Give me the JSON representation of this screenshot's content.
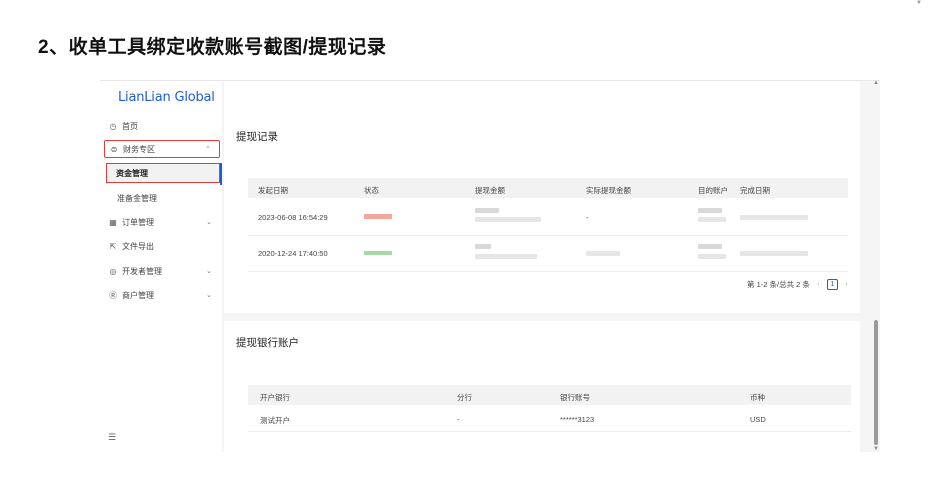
{
  "doc": {
    "heading": "2、收单工具绑定收款账号截图/提现记录"
  },
  "sidebar": {
    "logo": "LianLian Global",
    "items": [
      {
        "label": "首页",
        "icon": "clock-icon"
      },
      {
        "label": "财务专区",
        "icon": "money-icon"
      },
      {
        "label": "订单管理",
        "icon": "grid-icon"
      },
      {
        "label": "文件导出",
        "icon": "export-icon"
      },
      {
        "label": "开发者管理",
        "icon": "developer-icon"
      },
      {
        "label": "商户管理",
        "icon": "user-icon"
      }
    ],
    "sub_items": [
      {
        "label": "资金管理"
      },
      {
        "label": "准备金管理"
      }
    ]
  },
  "withdraw": {
    "title": "提现记录",
    "columns": [
      "发起日期",
      "状态",
      "提现金额",
      "实际提现金额",
      "目的账户",
      "完成日期"
    ],
    "rows": [
      {
        "date": "2023-06-08 16:54:29",
        "actual": "-",
        "status_color": "#f4a79a"
      },
      {
        "date": "2020-12-24 17:40:50",
        "actual": "",
        "status_color": "#a6d9a3"
      }
    ],
    "pagination": {
      "summary": "第 1-2 条/总共 2 条",
      "current": "1",
      "prev": "‹",
      "next": "›"
    }
  },
  "bank": {
    "title": "提现银行账户",
    "columns": [
      "开户银行",
      "分行",
      "银行账号",
      "币种"
    ],
    "rows": [
      {
        "bank": "测试开户",
        "branch": "-",
        "account": "******3123",
        "currency": "USD"
      }
    ]
  }
}
